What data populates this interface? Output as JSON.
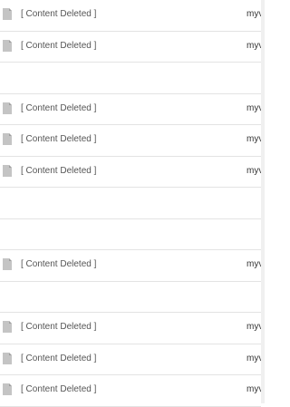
{
  "rows": [
    {
      "title": "[ Content Deleted ]",
      "owner": "myv"
    },
    {
      "title": "[ Content Deleted ]",
      "owner": "myv"
    },
    {
      "title": "",
      "owner": ""
    },
    {
      "title": "[ Content Deleted ]",
      "owner": "myv"
    },
    {
      "title": "[ Content Deleted ]",
      "owner": "myv"
    },
    {
      "title": "[ Content Deleted ]",
      "owner": "myv"
    },
    {
      "title": "",
      "owner": ""
    },
    {
      "title": "",
      "owner": ""
    },
    {
      "title": "[ Content Deleted ]",
      "owner": "myv"
    },
    {
      "title": "",
      "owner": ""
    },
    {
      "title": "[ Content Deleted ]",
      "owner": "myv"
    },
    {
      "title": "[ Content Deleted ]",
      "owner": "myv"
    },
    {
      "title": "[ Content Deleted ]",
      "owner": "myv"
    }
  ],
  "colors": {
    "border": "#e3e3e3",
    "icon": "#c4c4c4",
    "text": "#555555"
  },
  "icon": "document-icon"
}
